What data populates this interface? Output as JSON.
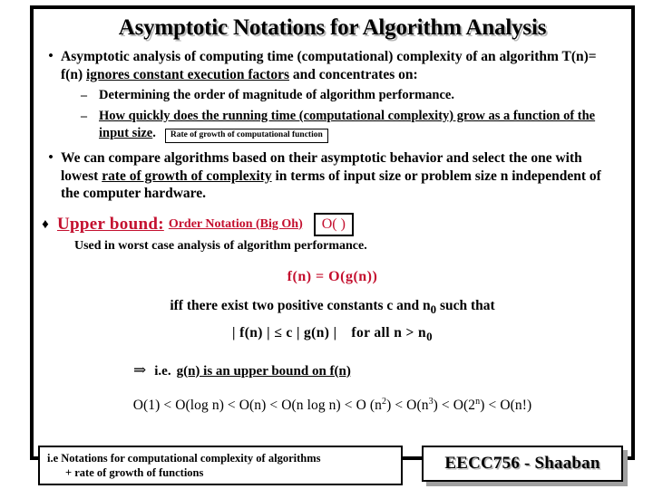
{
  "slide": {
    "title": "Asymptotic Notations for Algorithm Analysis",
    "bullets": [
      {
        "marker": "•",
        "text_parts": [
          {
            "text": "Asymptotic analysis of computing time (computational) complexity of an algorithm  T(n)= f(n) ",
            "underline": false
          },
          {
            "text": "ignores constant execution factors",
            "underline": true
          },
          {
            "text": " and concentrates on:",
            "underline": false
          }
        ]
      }
    ],
    "sub_bullets": [
      {
        "marker": "–",
        "text": "Determining the order of magnitude of algorithm performance.",
        "underline": false
      },
      {
        "marker": "–",
        "text": "How quickly does the running time (computational complexity) grow as a function of the input size",
        "trailing": ".",
        "underline": true
      }
    ],
    "annotation_box": "Rate of growth of computational function",
    "bullet2": {
      "marker": "•",
      "part1": "We can compare algorithms based on their asymptotic behavior and select the one with lowest ",
      "part2_underlined": "rate of growth of complexity",
      "part3": " in terms of input size or problem size n  independent of the computer hardware."
    },
    "upper_bound": {
      "diamond": "♦",
      "main_label": "Upper bound:",
      "sub_label": "Order Notation (Big Oh)",
      "order_box": "O( )",
      "note": "Used in worst case analysis of algorithm performance."
    },
    "formulas": {
      "definition": "f(n) = O(g(n))",
      "iff_line_a": "iff there exist two positive constants c and n",
      "iff_line_a_sub": "0",
      "iff_line_b": " such that",
      "inequality_a": "| f(n) | ≤ c | g(n) |",
      "inequality_b": "for all n > n",
      "inequality_b_sub": "0"
    },
    "implication": {
      "arrow": "⇒",
      "ie": "i.e.",
      "statement": "g(n)  is an upper bound on  f(n)"
    },
    "hierarchy": {
      "items": [
        {
          "label": "O(1)"
        },
        {
          "label": "O(log n)"
        },
        {
          "label": "O(n)"
        },
        {
          "label": "O(n log n)"
        },
        {
          "label": "O (n",
          "sup": "2",
          "close": ")"
        },
        {
          "label": "O(n",
          "sup": "3",
          "close": ")"
        },
        {
          "label": "O(2",
          "sup": "n",
          "close": ")"
        },
        {
          "label": "O(n!)"
        }
      ],
      "separator": "<"
    }
  },
  "footer": {
    "note_line1": "i.e  Notations for computational complexity of algorithms",
    "note_line2": "+ rate of growth of functions",
    "brand": "EECC756 - Shaaban"
  },
  "colors": {
    "accent_red": "#c4102f",
    "text_black": "#000000",
    "shadow_gray": "#a0a0a0",
    "background": "#ffffff"
  }
}
